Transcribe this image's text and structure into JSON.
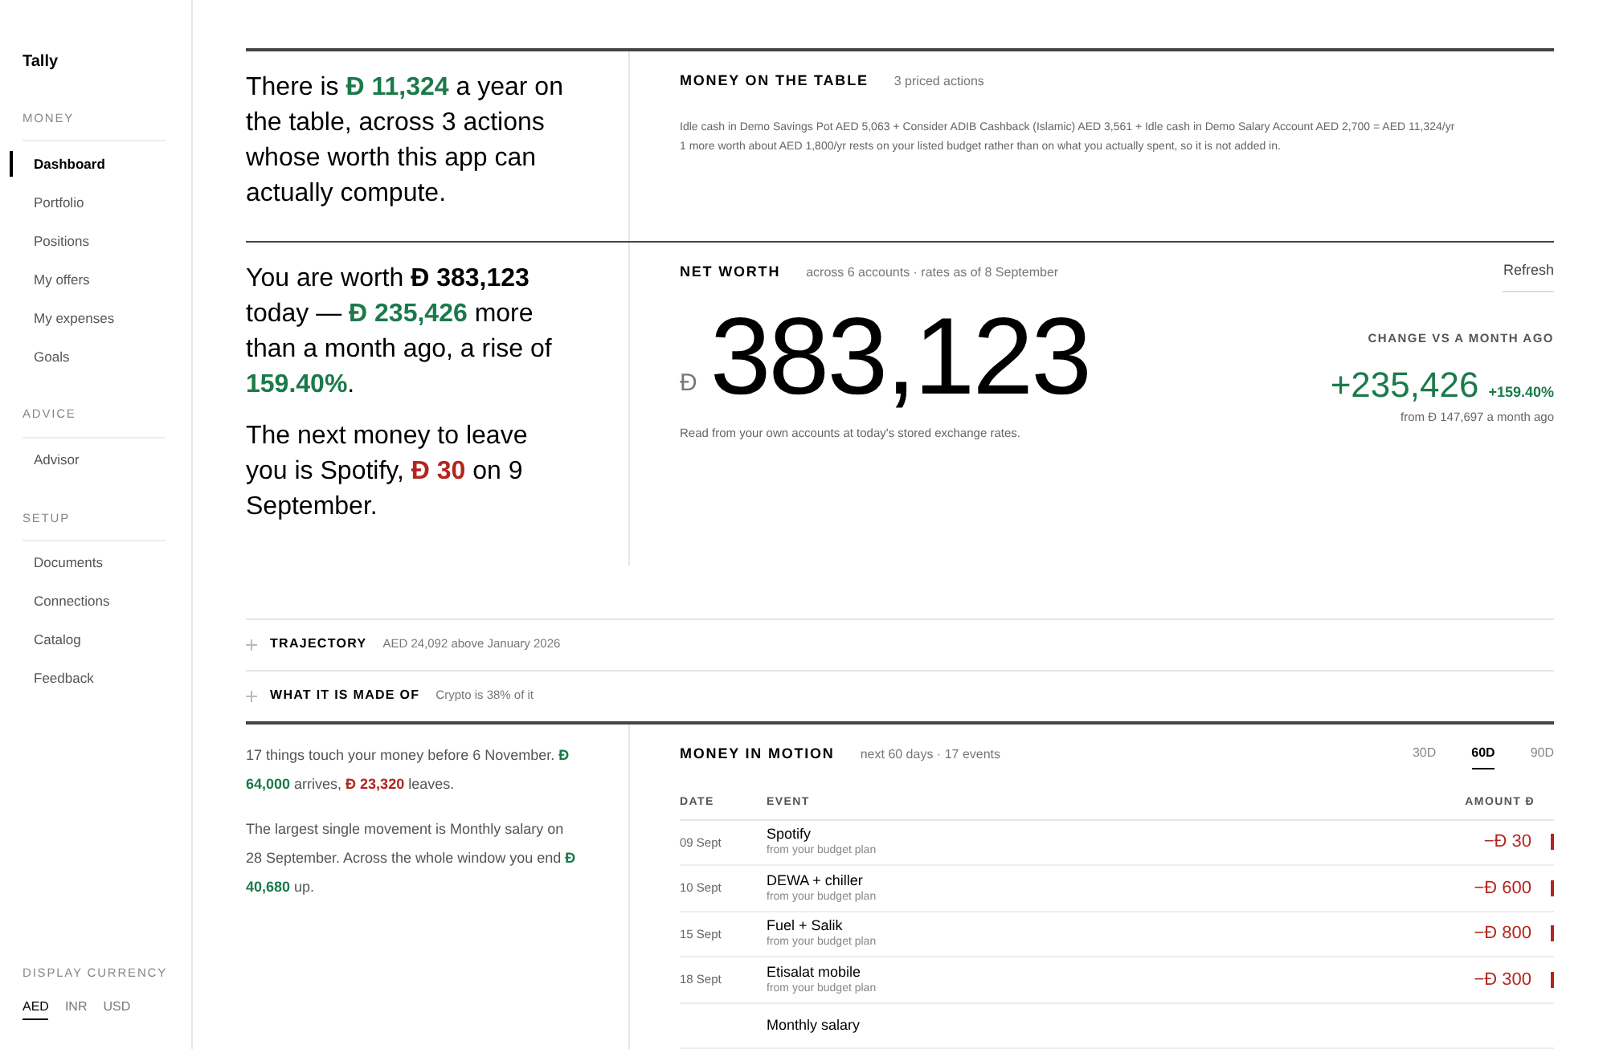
{
  "app": {
    "name": "Tally"
  },
  "sidebar": {
    "sections": [
      {
        "title": "MONEY",
        "items": [
          {
            "label": "Dashboard",
            "selected": true
          },
          {
            "label": "Portfolio",
            "selected": false
          },
          {
            "label": "Positions",
            "selected": false
          },
          {
            "label": "My offers",
            "selected": false
          },
          {
            "label": "My expenses",
            "selected": false
          },
          {
            "label": "Goals",
            "selected": false
          }
        ]
      },
      {
        "title": "ADVICE",
        "items": [
          {
            "label": "Advisor",
            "selected": false
          }
        ]
      },
      {
        "title": "SETUP",
        "items": [
          {
            "label": "Documents",
            "selected": false
          },
          {
            "label": "Connections",
            "selected": false
          },
          {
            "label": "Catalog",
            "selected": false
          },
          {
            "label": "Feedback",
            "selected": false
          }
        ]
      }
    ],
    "currency": {
      "title": "DISPLAY CURRENCY",
      "options": [
        {
          "label": "AED",
          "selected": true
        },
        {
          "label": "INR",
          "selected": false
        },
        {
          "label": "USD",
          "selected": false
        }
      ]
    }
  },
  "money_on_table": {
    "narrative": [
      {
        "text": "There is ",
        "kind": "plain"
      },
      {
        "text": "Đ 11,324",
        "kind": "gain"
      },
      {
        "text": " a year on the table, across 3 actions whose worth this app can actually compute.",
        "kind": "plain"
      }
    ],
    "title": "MONEY ON THE TABLE",
    "subtitle": "3 priced actions",
    "lines": [
      "Idle cash in Demo Savings Pot AED 5,063 + Consider ADIB Cashback (Islamic) AED 3,561 + Idle cash in Demo Salary Account AED 2,700 = AED 11,324/yr",
      "1 more worth about AED 1,800/yr rests on your listed budget rather than on what you actually spent, so it is not added in."
    ]
  },
  "net_worth": {
    "narratives": [
      [
        {
          "text": "You are worth ",
          "kind": "plain"
        },
        {
          "text": "Đ 383,123",
          "kind": "strong"
        },
        {
          "text": " today — ",
          "kind": "plain"
        },
        {
          "text": "Đ 235,426",
          "kind": "gain"
        },
        {
          "text": " more than a month ago, a rise of ",
          "kind": "plain"
        },
        {
          "text": "159.40%",
          "kind": "gain"
        },
        {
          "text": ".",
          "kind": "plain"
        }
      ],
      [
        {
          "text": "The next money to leave you is Spotify, ",
          "kind": "plain"
        },
        {
          "text": "Đ 30",
          "kind": "loss"
        },
        {
          "text": " on 9 September.",
          "kind": "plain"
        }
      ]
    ],
    "title": "NET WORTH",
    "subtitle": "across 6 accounts · rates as of 8 September",
    "refresh": "Refresh",
    "currency_symbol": "Đ",
    "value": "383,123",
    "note": "Read from your own accounts at today's stored exchange rates.",
    "change_title": "CHANGE VS A MONTH AGO",
    "change": "+235,426",
    "change_pct": "+159.40%",
    "change_from": "from Đ 147,697 a month ago"
  },
  "collapsibles": [
    {
      "title": "TRAJECTORY",
      "summary": "AED 24,092 above January 2026",
      "expanded": false
    },
    {
      "title": "WHAT IT IS MADE OF",
      "summary": "Crypto is 38% of it",
      "expanded": false
    }
  ],
  "money_in_motion": {
    "paragraphs": [
      [
        {
          "text": "17 things touch your money before 6 November. ",
          "kind": "plain"
        },
        {
          "text": "Đ 64,000",
          "kind": "gain"
        },
        {
          "text": " arrives, ",
          "kind": "plain"
        },
        {
          "text": "Đ 23,320",
          "kind": "loss"
        },
        {
          "text": " leaves.",
          "kind": "plain"
        }
      ],
      [
        {
          "text": "The largest single movement is Monthly salary on 28 September. Across the whole window you end ",
          "kind": "plain"
        },
        {
          "text": "Đ 40,680",
          "kind": "gain"
        },
        {
          "text": " up.",
          "kind": "plain"
        }
      ]
    ],
    "title": "MONEY IN MOTION",
    "subtitle": "next 60 days · 17 events",
    "ranges": [
      {
        "label": "30D",
        "selected": false
      },
      {
        "label": "60D",
        "selected": true
      },
      {
        "label": "90D",
        "selected": false
      }
    ],
    "columns": [
      "DATE",
      "EVENT",
      "AMOUNT Đ"
    ],
    "rows": [
      {
        "date": "09 Sept",
        "event": "Spotify",
        "source": "from your budget plan",
        "amount": "−Đ 30",
        "kind": "out"
      },
      {
        "date": "10 Sept",
        "event": "DEWA + chiller",
        "source": "from your budget plan",
        "amount": "−Đ 600",
        "kind": "out"
      },
      {
        "date": "15 Sept",
        "event": "Fuel + Salik",
        "source": "from your budget plan",
        "amount": "−Đ 800",
        "kind": "out"
      },
      {
        "date": "18 Sept",
        "event": "Etisalat mobile",
        "source": "from your budget plan",
        "amount": "−Đ 300",
        "kind": "out"
      },
      {
        "event": "Monthly salary",
        "kind": "in"
      }
    ]
  }
}
